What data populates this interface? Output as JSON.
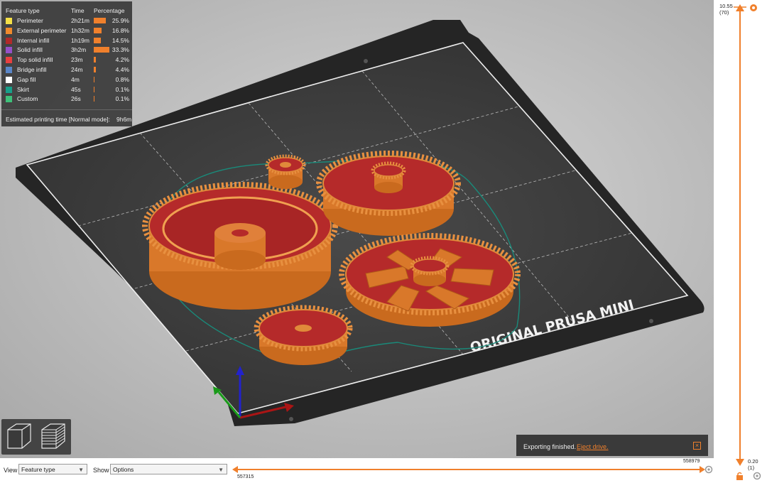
{
  "legend": {
    "headers": {
      "feature": "Feature type",
      "time": "Time",
      "percentage": "Percentage"
    },
    "rows": [
      {
        "name": "Perimeter",
        "time": "2h21m",
        "pct": "25.9%",
        "value": 25.9,
        "color": "#f5e047"
      },
      {
        "name": "External perimeter",
        "time": "1h32m",
        "pct": "16.8%",
        "value": 16.8,
        "color": "#f08a2c"
      },
      {
        "name": "Internal infill",
        "time": "1h19m",
        "pct": "14.5%",
        "value": 14.5,
        "color": "#b02a2a"
      },
      {
        "name": "Solid infill",
        "time": "3h2m",
        "pct": "33.3%",
        "value": 33.3,
        "color": "#9550c8"
      },
      {
        "name": "Top solid infill",
        "time": "23m",
        "pct": "4.2%",
        "value": 4.2,
        "color": "#e84040"
      },
      {
        "name": "Bridge infill",
        "time": "24m",
        "pct": "4.4%",
        "value": 4.4,
        "color": "#5a86c8"
      },
      {
        "name": "Gap fill",
        "time": "4m",
        "pct": "0.8%",
        "value": 0.8,
        "color": "#ffffff"
      },
      {
        "name": "Skirt",
        "time": "45s",
        "pct": "0.1%",
        "value": 0.1,
        "color": "#18a08a"
      },
      {
        "name": "Custom",
        "time": "26s",
        "pct": "0.1%",
        "value": 0.1,
        "color": "#3ec07a"
      }
    ],
    "estimate_label": "Estimated printing time [Normal mode]:",
    "estimate_value": "9h6m"
  },
  "bed_label": "ORIGINAL PRUSA MINI",
  "toast": {
    "message": "Exporting finished.",
    "link": "Eject drive."
  },
  "vertical_slider": {
    "top_value": "10.55",
    "top_layer": "(70)",
    "bottom_value": "0.20",
    "bottom_layer": "(1)"
  },
  "bottom_bar": {
    "view_label": "View",
    "view_value": "Feature type",
    "show_label": "Show",
    "show_value": "Options",
    "move_start": "557315",
    "move_end": "558979"
  },
  "colors": {
    "accent": "#f0802c",
    "gear_fill": "#b52a2a",
    "bed": "#333333"
  }
}
